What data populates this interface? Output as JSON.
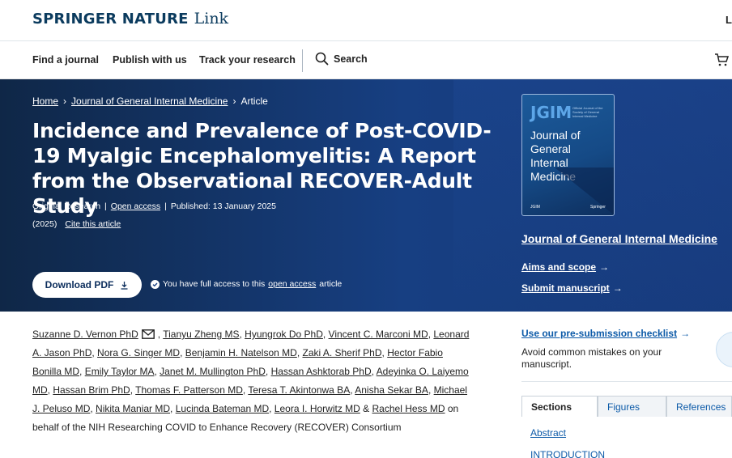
{
  "brand": {
    "name": "SPRINGER NATURE",
    "link": "Link",
    "login": "L"
  },
  "nav": {
    "items": [
      "Find a journal",
      "Publish with us",
      "Track your research"
    ],
    "search_label": "Search"
  },
  "breadcrumb": {
    "home": "Home",
    "journal": "Journal of General Internal Medicine",
    "current": "Article"
  },
  "article": {
    "title": "Incidence and Prevalence of Post-COVID-19 Myalgic Encephalomyelitis: A Report from the Observational RECOVER-Adult Study",
    "type": "Original Research",
    "access": "Open access",
    "published": "Published: 13 January 2025",
    "year": "(2025)",
    "cite": "Cite this article",
    "download_pdf": "Download PDF",
    "access_note_pre": "You have full access to this",
    "access_note_link": "open access",
    "access_note_post": "article"
  },
  "journal": {
    "cover_abbrev": "JGIM",
    "cover_small": "Official Journal of the Society of General Internal Medicine",
    "cover_name": "Journal of General Internal Medicine",
    "cover_logo": "JGIM",
    "cover_publisher": "Springer",
    "name": "Journal of General Internal Medicine",
    "aims": "Aims and scope",
    "submit": "Submit manuscript"
  },
  "authors": {
    "list": [
      "Suzanne D. Vernon PhD",
      "Tianyu Zheng MS",
      "Hyungrok Do PhD",
      "Vincent C. Marconi MD",
      "Leonard A. Jason PhD",
      "Nora G. Singer MD",
      "Benjamin H. Natelson MD",
      "Zaki A. Sherif PhD",
      "Hector Fabio Bonilla MD",
      "Emily Taylor MA",
      "Janet M. Mullington PhD",
      "Hassan Ashktorab PhD",
      "Adeyinka O. Laiyemo MD",
      "Hassan Brim PhD",
      "Thomas F. Patterson MD",
      "Teresa T. Akintonwa BA",
      "Anisha Sekar BA",
      "Michael J. Peluso MD",
      "Nikita Maniar MD",
      "Lucinda Bateman MD",
      "Leora I. Horwitz MD",
      "Rachel Hess MD"
    ],
    "suffix": "on behalf of the NIH Researching COVID to Enhance Recovery (RECOVER) Consortium"
  },
  "sidebar": {
    "checklist": "Use our pre-submission checklist",
    "checklist_desc": "Avoid common mistakes on your manuscript.",
    "tabs": [
      "Sections",
      "Figures",
      "References"
    ],
    "sections": [
      "Abstract",
      "INTRODUCTION"
    ]
  }
}
